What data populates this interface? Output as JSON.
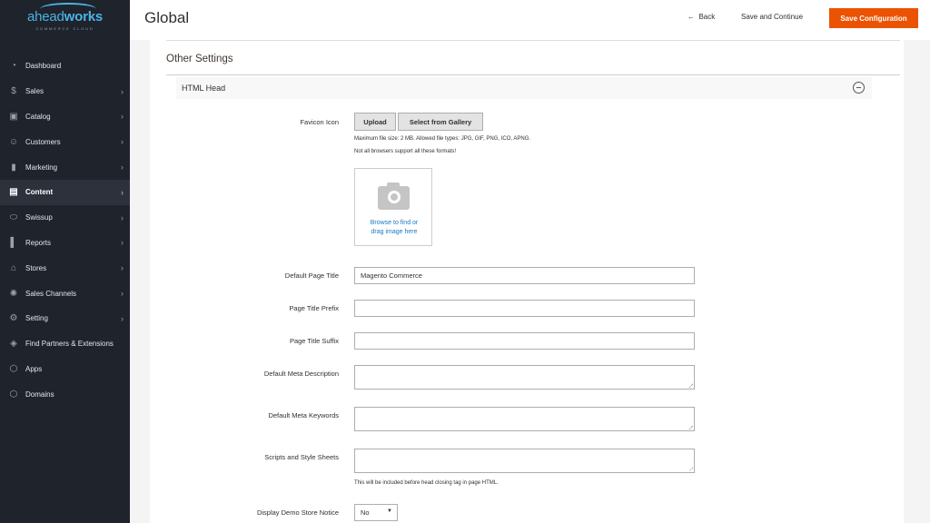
{
  "brand": {
    "name_part1": "ahead",
    "name_part2": "works",
    "tagline": "COMMERCE CLOUD"
  },
  "sidebar": {
    "items": [
      {
        "label": "Dashboard",
        "icon": "dashboard-icon",
        "chevron": false
      },
      {
        "label": "Sales",
        "icon": "dollar-icon",
        "chevron": true
      },
      {
        "label": "Catalog",
        "icon": "box-icon",
        "chevron": true
      },
      {
        "label": "Customers",
        "icon": "customers-icon",
        "chevron": true
      },
      {
        "label": "Marketing",
        "icon": "marketing-icon",
        "chevron": true
      },
      {
        "label": "Content",
        "icon": "content-icon",
        "chevron": true,
        "active": true
      },
      {
        "label": "Swissup",
        "icon": "swissup-icon",
        "chevron": true
      },
      {
        "label": "Reports",
        "icon": "reports-icon",
        "chevron": true
      },
      {
        "label": "Stores",
        "icon": "store-icon",
        "chevron": true
      },
      {
        "label": "Sales Channels",
        "icon": "channels-icon",
        "chevron": true
      },
      {
        "label": "Setting",
        "icon": "gear-icon",
        "chevron": true
      },
      {
        "label": "Find Partners & Extensions",
        "icon": "cube-icon",
        "chevron": false
      },
      {
        "label": "Apps",
        "icon": "hexagon-icon",
        "chevron": false
      },
      {
        "label": "Domains",
        "icon": "hexagon-icon",
        "chevron": false
      }
    ]
  },
  "header": {
    "title": "Global",
    "back_label": "Back",
    "save_continue_label": "Save and Continue",
    "save_config_label": "Save Configuration"
  },
  "section": {
    "title": "Other Settings",
    "group_title": "HTML Head"
  },
  "form": {
    "favicon_label": "Favicon Icon",
    "upload_label": "Upload",
    "gallery_label": "Select from Gallery",
    "note_size": "Maximum file size: 2 MB. Allowed file types: JPG, GIF, PNG, ICO, APNG.",
    "note_browsers": "Not all browsers support all these formats!",
    "browse_line1": "Browse to find or",
    "browse_line2": "drag image here",
    "default_title_label": "Default Page Title",
    "default_title_value": "Magento Commerce",
    "prefix_label": "Page Title Prefix",
    "prefix_value": "",
    "suffix_label": "Page Title Suffix",
    "suffix_value": "",
    "meta_desc_label": "Default Meta Description",
    "meta_keywords_label": "Default Meta Keywords",
    "scripts_label": "Scripts and Style Sheets",
    "scripts_note": "This will be included before head closing tag in page HTML.",
    "demo_notice_label": "Display Demo Store Notice",
    "demo_notice_value": "No"
  },
  "colors": {
    "accent": "#eb5202",
    "sidebar_bg": "#1f232b",
    "link": "#1979c3"
  }
}
